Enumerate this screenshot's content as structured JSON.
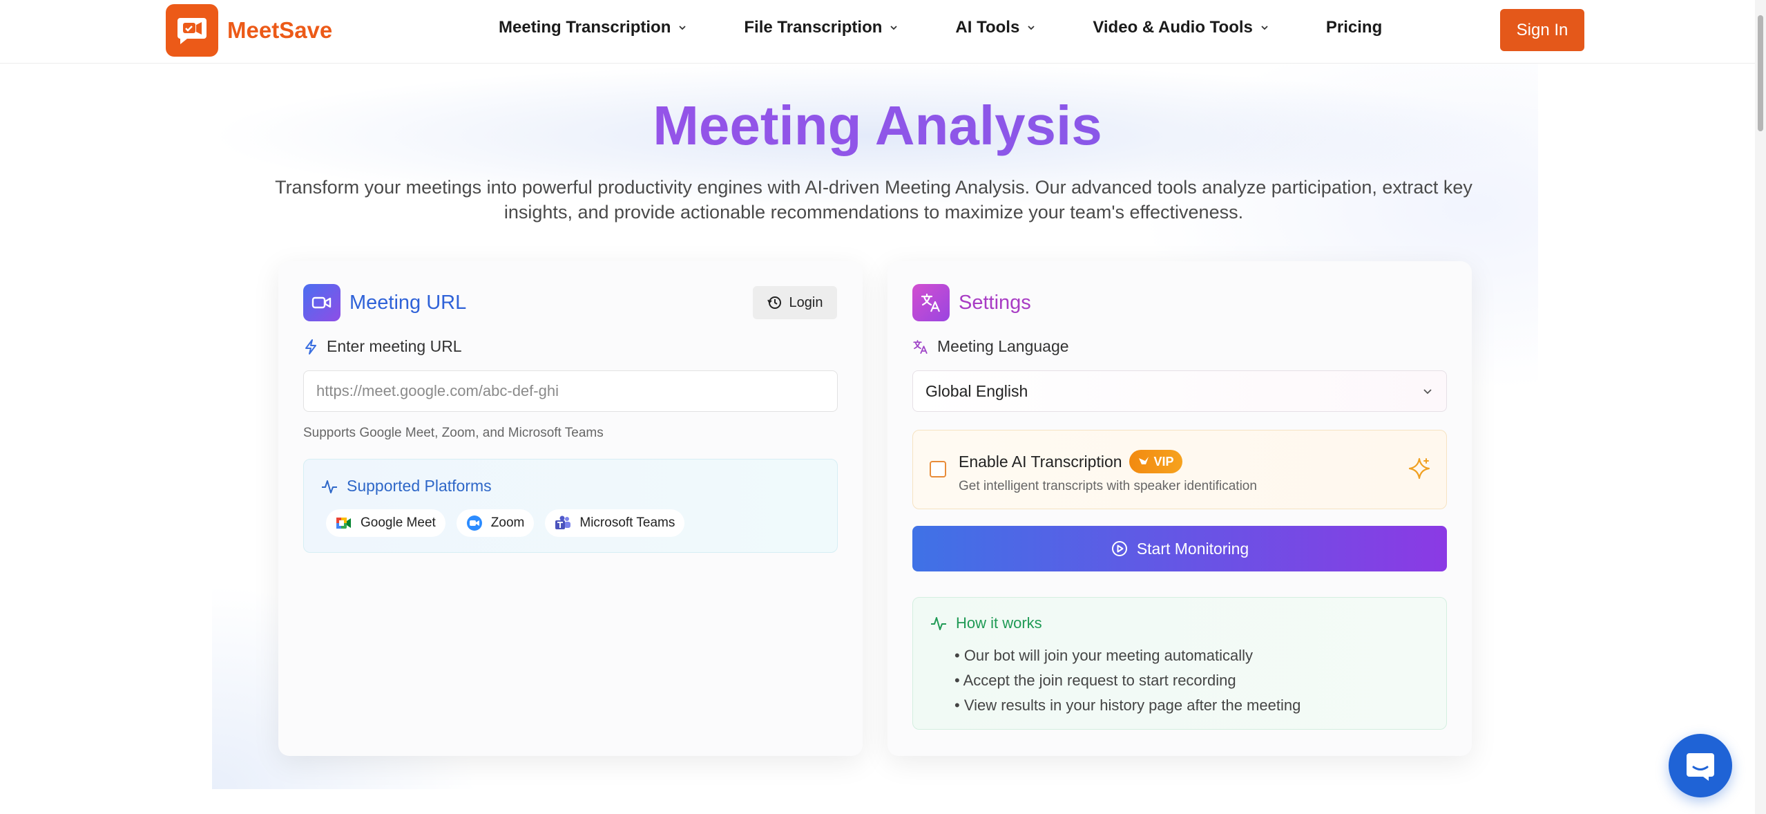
{
  "brand": {
    "name": "MeetSave",
    "color": "#ec5a18"
  },
  "nav": {
    "items": [
      {
        "label": "Meeting Transcription",
        "has_dropdown": true
      },
      {
        "label": "File Transcription",
        "has_dropdown": true
      },
      {
        "label": "AI Tools",
        "has_dropdown": true
      },
      {
        "label": "Video & Audio Tools",
        "has_dropdown": true
      },
      {
        "label": "Pricing",
        "has_dropdown": false
      }
    ],
    "sign_in_label": "Sign In"
  },
  "hero": {
    "title": "Meeting Analysis",
    "subtitle": "Transform your meetings into powerful productivity engines with AI-driven Meeting Analysis. Our advanced tools analyze participation, extract key insights, and provide actionable recommendations to maximize your team's effectiveness."
  },
  "meeting_card": {
    "title": "Meeting URL",
    "login_label": "Login",
    "url_label": "Enter meeting URL",
    "url_placeholder": "https://meet.google.com/abc-def-ghi",
    "url_value": "",
    "hint": "Supports Google Meet, Zoom, and Microsoft Teams",
    "platforms_title": "Supported Platforms",
    "platforms": [
      {
        "name": "Google Meet",
        "icon": "google-meet-icon"
      },
      {
        "name": "Zoom",
        "icon": "zoom-icon"
      },
      {
        "name": "Microsoft Teams",
        "icon": "microsoft-teams-icon"
      }
    ]
  },
  "settings_card": {
    "title": "Settings",
    "language_label": "Meeting Language",
    "language_value": "Global English",
    "ai_transcription": {
      "label": "Enable AI Transcription",
      "badge": "VIP",
      "description": "Get intelligent transcripts with speaker identification",
      "checked": false
    },
    "start_label": "Start Monitoring",
    "how_title": "How it works",
    "how_steps": [
      "• Our bot will join your meeting automatically",
      "• Accept the join request to start recording",
      "• View results in your history page after the meeting"
    ]
  },
  "colors": {
    "primary_orange": "#e4581a",
    "title_gradient_start": "#a24fe6",
    "title_gradient_end": "#7c5cea",
    "start_gradient_start": "#3f72e6",
    "start_gradient_end": "#8b3ae4",
    "how_green": "#1f9a55"
  }
}
